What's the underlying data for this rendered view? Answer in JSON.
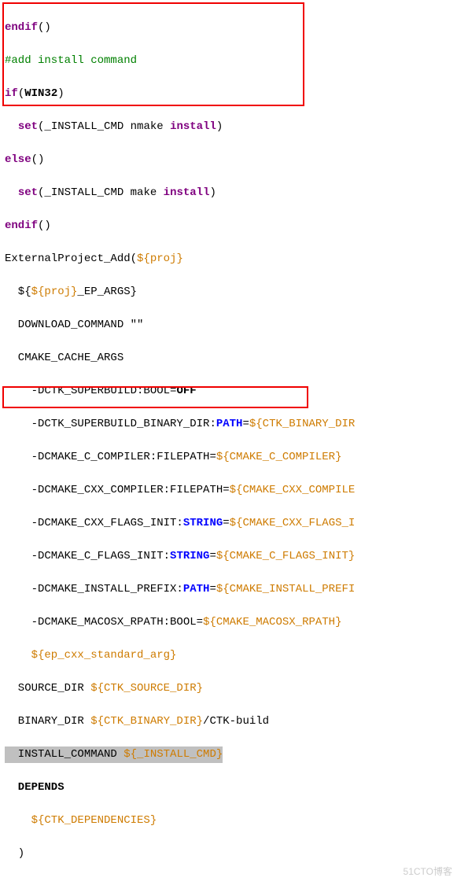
{
  "l0": {
    "a": "endif",
    "b": "()"
  },
  "l1": "#add install command",
  "l2": {
    "a": "if",
    "b": "(",
    "c": "WIN32",
    "d": ")"
  },
  "l3": {
    "a": "  ",
    "b": "set",
    "c": "(_INSTALL_CMD nmake ",
    "d": "install",
    "e": ")"
  },
  "l4": {
    "a": "else",
    "b": "()"
  },
  "l5": {
    "a": "  ",
    "b": "set",
    "c": "(_INSTALL_CMD make ",
    "d": "install",
    "e": ")"
  },
  "l6": {
    "a": "endif",
    "b": "()"
  },
  "l7": {
    "a": "ExternalProject_Add(",
    "b": "${proj}"
  },
  "l8": {
    "a": "  ${",
    "b": "${proj}",
    "c": "_EP_ARGS}"
  },
  "l9": "  DOWNLOAD_COMMAND \"\"",
  "l10": "  CMAKE_CACHE_ARGS",
  "l11": {
    "a": "    -DCTK_SUPERBUILD:BOOL=",
    "b": "OFF"
  },
  "l12": {
    "a": "    -DCTK_SUPERBUILD_BINARY_DIR:",
    "b": "PATH",
    "c": "=",
    "d": "${CTK_BINARY_DIR"
  },
  "l13": {
    "a": "    -DCMAKE_C_COMPILER:FILEPATH=",
    "b": "${CMAKE_C_COMPILER}"
  },
  "l14": {
    "a": "    -DCMAKE_CXX_COMPILER:FILEPATH=",
    "b": "${CMAKE_CXX_COMPILE"
  },
  "l15": {
    "a": "    -DCMAKE_CXX_FLAGS_INIT:",
    "b": "STRING",
    "c": "=",
    "d": "${CMAKE_CXX_FLAGS_I"
  },
  "l16": {
    "a": "    -DCMAKE_C_FLAGS_INIT:",
    "b": "STRING",
    "c": "=",
    "d": "${CMAKE_C_FLAGS_INIT}"
  },
  "l17": {
    "a": "    -DCMAKE_INSTALL_PREFIX:",
    "b": "PATH",
    "c": "=",
    "d": "${CMAKE_INSTALL_PREFI"
  },
  "l18": {
    "a": "    -DCMAKE_MACOSX_RPATH:BOOL=",
    "b": "${CMAKE_MACOSX_RPATH}"
  },
  "l19": "    ${ep_cxx_standard_arg}",
  "l20": {
    "a": "  SOURCE_DIR ",
    "b": "${CTK_SOURCE_DIR}"
  },
  "l21": {
    "a": "  BINARY_DIR ",
    "b": "${CTK_BINARY_DIR}",
    "c": "/CTK-build"
  },
  "l22": {
    "a": "  INSTALL_COMMAND ",
    "b": "${_INSTALL_CMD}"
  },
  "l23": "  DEPENDS",
  "l24": "    ${CTK_DEPENDENCIES}",
  "l25": "  )",
  "watermark": "51CTO博客"
}
